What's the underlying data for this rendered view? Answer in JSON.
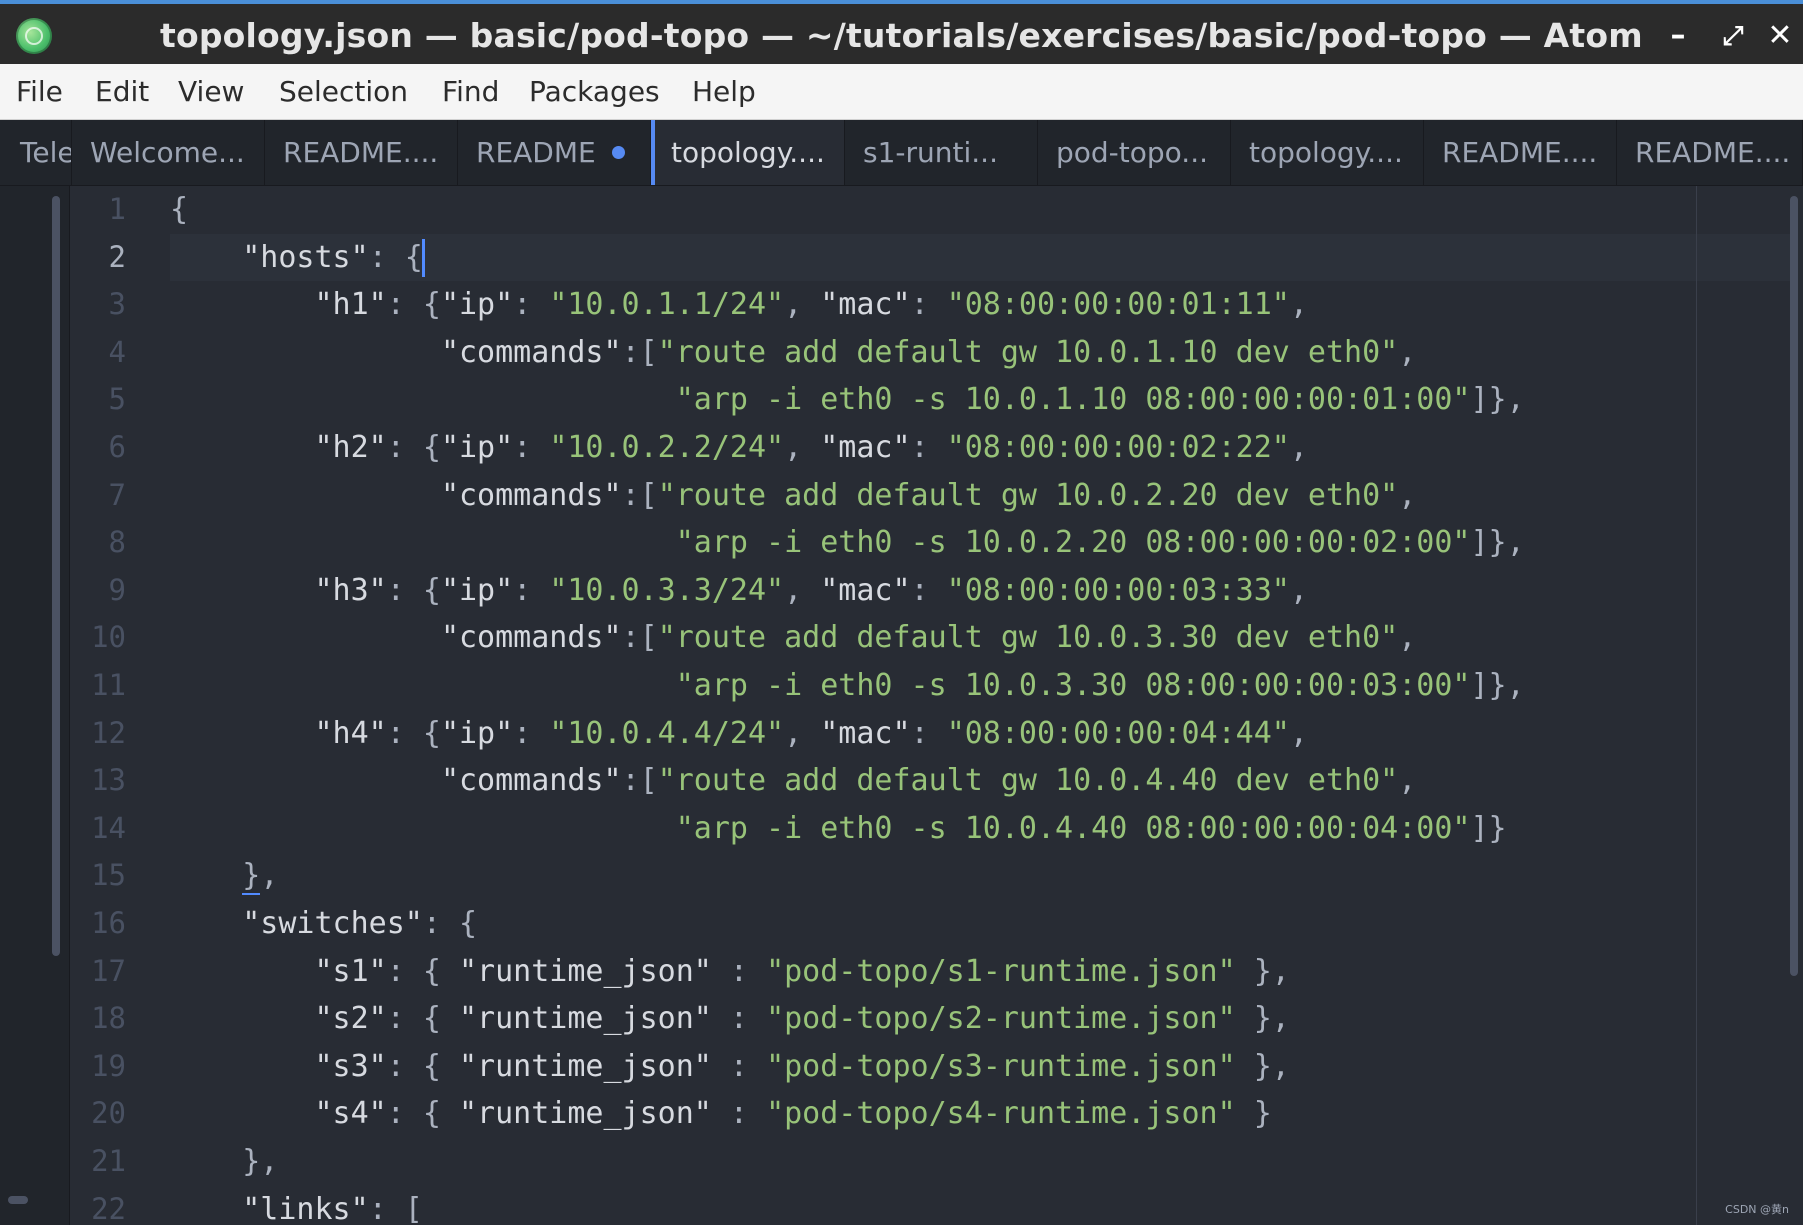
{
  "window": {
    "title": "topology.json — basic/pod-topo — ~/tutorials/exercises/basic/pod-topo — Atom",
    "minimize_glyph": "–",
    "maximize_glyph": "⤢",
    "close_glyph": "✕",
    "app_icon": "atom-logo-icon"
  },
  "menubar": {
    "items": [
      "File",
      "Edit",
      "View",
      "Selection",
      "Find",
      "Packages",
      "Help"
    ]
  },
  "tabs": [
    {
      "label": "Tele",
      "active": false,
      "modified": false
    },
    {
      "label": "Welcome...",
      "active": false,
      "modified": false
    },
    {
      "label": "README....",
      "active": false,
      "modified": false
    },
    {
      "label": "README",
      "active": false,
      "modified": true
    },
    {
      "label": "topology....",
      "active": true,
      "modified": false
    },
    {
      "label": "s1-runti...",
      "active": false,
      "modified": false
    },
    {
      "label": "pod-topo...",
      "active": false,
      "modified": false
    },
    {
      "label": "topology....",
      "active": false,
      "modified": false
    },
    {
      "label": "README....",
      "active": false,
      "modified": false
    },
    {
      "label": "README....",
      "active": false,
      "modified": false
    }
  ],
  "editor": {
    "current_line": 2,
    "line_numbers": [
      "1",
      "2",
      "3",
      "4",
      "5",
      "6",
      "7",
      "8",
      "9",
      "10",
      "11",
      "12",
      "13",
      "14",
      "15",
      "16",
      "17",
      "18",
      "19",
      "20",
      "21",
      "22"
    ],
    "lines": [
      "{",
      "    \"hosts\": {",
      "        \"h1\": {\"ip\": \"10.0.1.1/24\", \"mac\": \"08:00:00:00:01:11\",",
      "               \"commands\":[\"route add default gw 10.0.1.10 dev eth0\",",
      "                            \"arp -i eth0 -s 10.0.1.10 08:00:00:00:01:00\"]},",
      "        \"h2\": {\"ip\": \"10.0.2.2/24\", \"mac\": \"08:00:00:00:02:22\",",
      "               \"commands\":[\"route add default gw 10.0.2.20 dev eth0\",",
      "                            \"arp -i eth0 -s 10.0.2.20 08:00:00:00:02:00\"]},",
      "        \"h3\": {\"ip\": \"10.0.3.3/24\", \"mac\": \"08:00:00:00:03:33\",",
      "               \"commands\":[\"route add default gw 10.0.3.30 dev eth0\",",
      "                            \"arp -i eth0 -s 10.0.3.30 08:00:00:00:03:00\"]},",
      "        \"h4\": {\"ip\": \"10.0.4.4/24\", \"mac\": \"08:00:00:00:04:44\",",
      "               \"commands\":[\"route add default gw 10.0.4.40 dev eth0\",",
      "                            \"arp -i eth0 -s 10.0.4.40 08:00:00:00:04:00\"]}",
      "    },",
      "    \"switches\": {",
      "        \"s1\": { \"runtime_json\" : \"pod-topo/s1-runtime.json\" },",
      "        \"s2\": { \"runtime_json\" : \"pod-topo/s2-runtime.json\" },",
      "        \"s3\": { \"runtime_json\" : \"pod-topo/s3-runtime.json\" },",
      "        \"s4\": { \"runtime_json\" : \"pod-topo/s4-runtime.json\" }",
      "    },",
      "    \"links\": ["
    ]
  },
  "watermark": "CSDN @黄n",
  "colors": {
    "accent": "#568af2",
    "string": "#98c379",
    "text": "#abb2bf",
    "background": "#282c34",
    "titlebar_border": "#4a8fd8"
  }
}
